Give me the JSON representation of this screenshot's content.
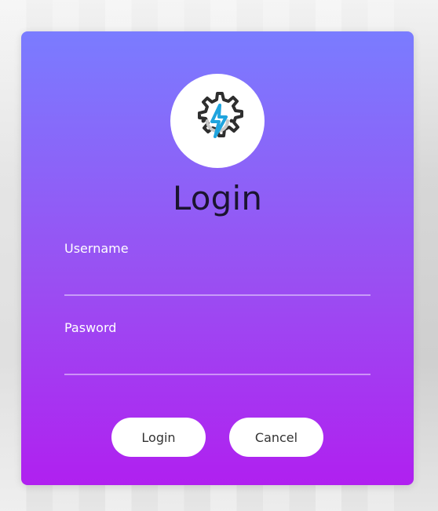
{
  "login_card": {
    "title": "Login",
    "username_label": "Username",
    "username_value": "",
    "password_label": "Pasword",
    "password_value": "",
    "buttons": {
      "login": "Login",
      "cancel": "Cancel"
    },
    "logo_icon": "gear-lightning-icon"
  },
  "colors": {
    "card_gradient_top": "#7a7cff",
    "card_gradient_bottom": "#b020f0",
    "title_text": "#1b1430",
    "button_bg": "#ffffff"
  }
}
